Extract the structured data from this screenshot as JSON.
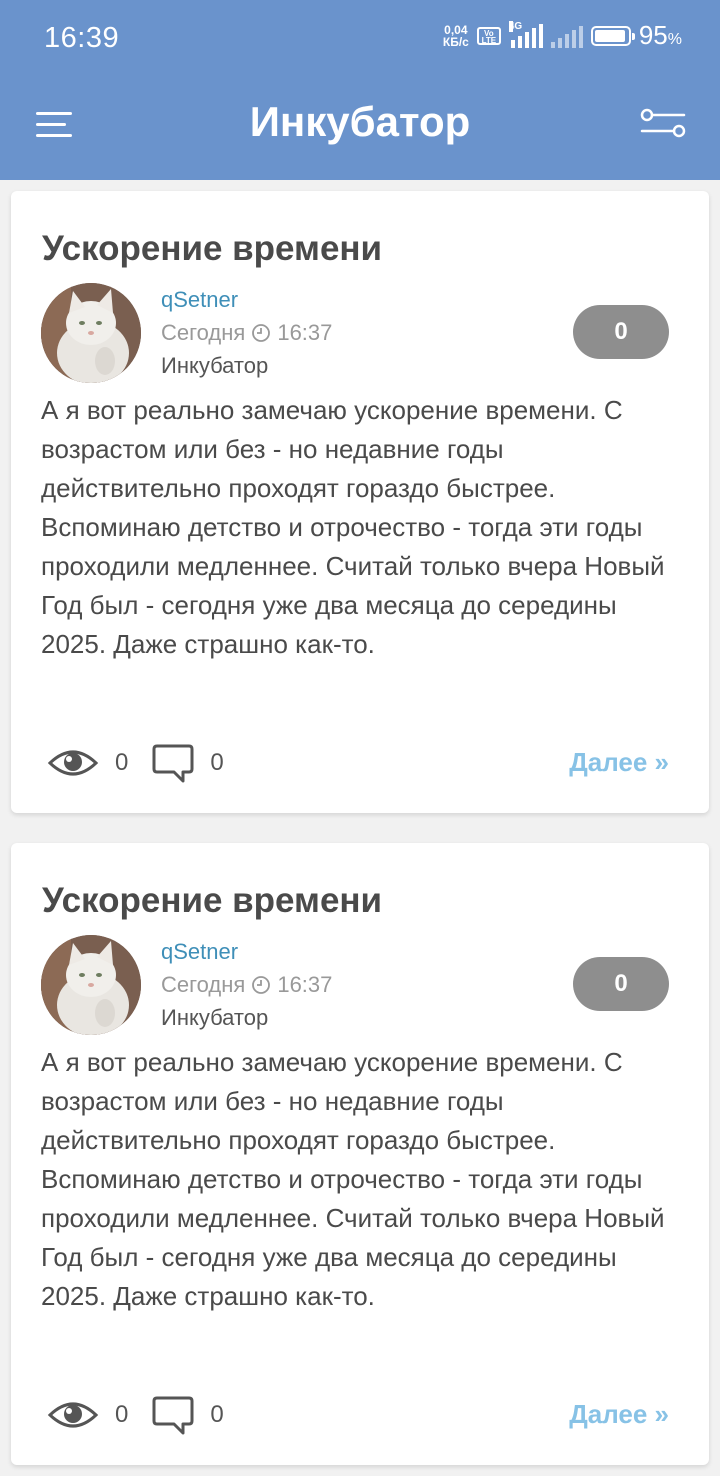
{
  "status_bar": {
    "time": "16:39",
    "net_speed_value": "0,04",
    "net_speed_unit": "КБ/с",
    "volte": "Vo LTE",
    "network": "4G",
    "battery_percent": "95",
    "battery_unit": "%",
    "battery_level": 0.95
  },
  "header": {
    "title": "Инкубатор",
    "menu_icon": "hamburger-menu-icon",
    "filter_icon": "filter-sliders-icon",
    "background_color": "#6a93cc"
  },
  "posts": [
    {
      "title": "Ускорение времени",
      "author": "qSetner",
      "date": "Сегодня",
      "time": "16:37",
      "category": "Инкубатор",
      "rating": "0",
      "body": "А я вот реально замечаю ускорение времени. С возрастом или без - но недавние годы действительно проходят гораздо быстрее. Вспоминаю детство и отрочество - тогда эти годы проходили медленнее. Считай только вчера Новый Год был - сегодня уже два месяца до середины 2025. Даже страшно как-то.",
      "views": "0",
      "comments": "0",
      "more": "Далее »"
    },
    {
      "title": "Ускорение времени",
      "author": "qSetner",
      "date": "Сегодня",
      "time": "16:37",
      "category": "Инкубатор",
      "rating": "0",
      "body": "А я вот реально замечаю ускорение времени. С возрастом или без - но недавние годы действительно проходят гораздо быстрее. Вспоминаю детство и отрочество - тогда эти годы проходили медленнее. Считай только вчера Новый Год был - сегодня уже два месяца до середины 2025. Даже страшно как-то.",
      "views": "0",
      "comments": "0",
      "more": "Далее »"
    }
  ],
  "colors": {
    "author_link": "#3f8fb8",
    "more_link": "#87c2e6",
    "rating_badge": "#8e8e8e"
  }
}
